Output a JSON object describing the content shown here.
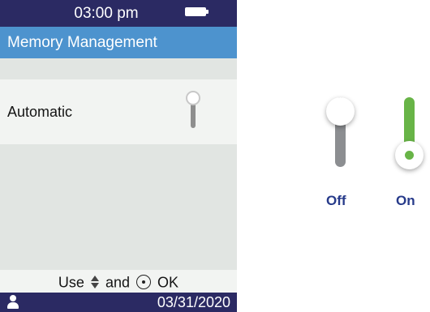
{
  "status_bar": {
    "time": "03:00 pm",
    "battery_icon": "battery-icon"
  },
  "header": {
    "title": "Memory Management"
  },
  "settings": {
    "items": [
      {
        "label": "Automatic",
        "toggle_state": "off"
      }
    ]
  },
  "hint": {
    "use": "Use",
    "and": "and",
    "ok": "OK",
    "icons": [
      "up-down-arrows-icon",
      "ok-button-icon"
    ]
  },
  "footer": {
    "user_icon": "user-icon",
    "date": "03/31/2020"
  },
  "legend": {
    "off_label": "Off",
    "on_label": "On",
    "colors": {
      "off_track": "#8c8e91",
      "on_track": "#68b447",
      "label": "#263a8a"
    }
  },
  "colors": {
    "status_bar": "#2b2a63",
    "title_bar": "#4d93ce",
    "content_bg": "#e1e5e2",
    "row_bg": "#f2f4f2"
  }
}
